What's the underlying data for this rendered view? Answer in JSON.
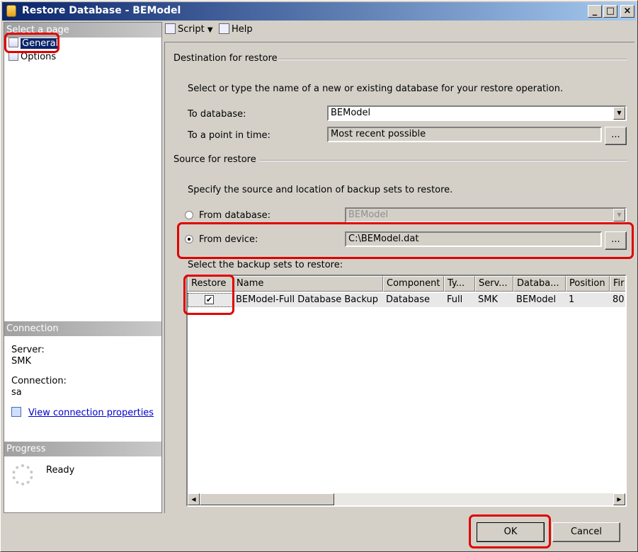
{
  "window": {
    "title": "Restore Database - BEModel",
    "controls": {
      "minimize": "_",
      "maximize": "□",
      "close": "×"
    }
  },
  "sidebar": {
    "select_page_header": "Select a page",
    "pages": [
      {
        "label": "General",
        "icon": "page-icon",
        "selected": true
      },
      {
        "label": "Options",
        "icon": "page-icon",
        "selected": false
      }
    ],
    "connection_header": "Connection",
    "server_label": "Server:",
    "server_value": "SMK",
    "connection_label": "Connection:",
    "connection_value": "sa",
    "view_connection_link": "View connection properties",
    "progress_header": "Progress",
    "progress_status": "Ready"
  },
  "toolbar": {
    "script_label": "Script",
    "help_label": "Help"
  },
  "destination": {
    "group_title": "Destination for restore",
    "instructions": "Select or type the name of a new or existing database for your restore operation.",
    "to_database_label": "To database:",
    "to_database_value": "BEModel",
    "point_in_time_label": "To a point in time:",
    "point_in_time_value": "Most recent possible",
    "browse_label": "..."
  },
  "source": {
    "group_title": "Source for restore",
    "instructions": "Specify the source and location of backup sets to restore.",
    "from_database_label": "From database:",
    "from_database_value": "BEModel",
    "from_device_label": "From device:",
    "from_device_value": "C:\\BEModel.dat",
    "browse_label": "...",
    "selected_source": "device"
  },
  "backup_sets": {
    "label": "Select the backup sets to restore:",
    "columns": [
      "Restore",
      "Name",
      "Component",
      "Ty...",
      "Serv...",
      "Databa...",
      "Position",
      "Fir"
    ],
    "rows": [
      {
        "restore": true,
        "name": "BEModel-Full Database Backup",
        "component": "Database",
        "type": "Full",
        "server": "SMK",
        "database": "BEModel",
        "position": "1",
        "first": "80"
      }
    ]
  },
  "footer": {
    "ok_label": "OK",
    "cancel_label": "Cancel"
  },
  "colors": {
    "highlight": "#e00000",
    "title_bar": "#0a246a",
    "link": "#0000cc"
  }
}
